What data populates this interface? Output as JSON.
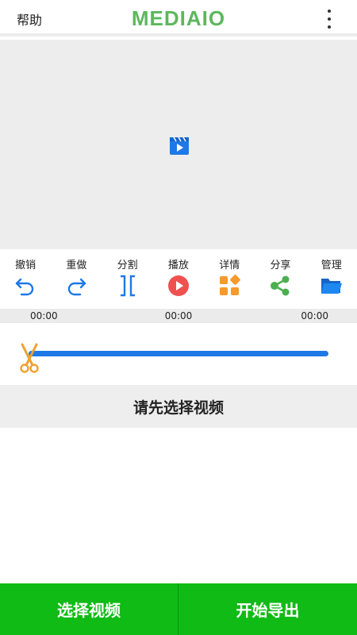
{
  "header": {
    "help_label": "帮助",
    "logo_text": "MEDIAIO",
    "logo_color": "#5cb85c"
  },
  "toolbar": {
    "items": [
      {
        "label": "撤销",
        "icon": "undo-icon",
        "color": "#1e78e6"
      },
      {
        "label": "重做",
        "icon": "redo-icon",
        "color": "#1e78e6"
      },
      {
        "label": "分割",
        "icon": "split-icon",
        "color": "#1e78e6"
      },
      {
        "label": "播放",
        "icon": "play-icon",
        "color": "#f05050"
      },
      {
        "label": "详情",
        "icon": "details-icon",
        "color": "#f59a2b"
      },
      {
        "label": "分享",
        "icon": "share-icon",
        "color": "#4caf50"
      },
      {
        "label": "管理",
        "icon": "folder-icon",
        "color": "#1e78e6"
      }
    ]
  },
  "timebar": {
    "start": "00:00",
    "current": "00:00",
    "end": "00:00"
  },
  "notice": "请先选择视频",
  "bottom": {
    "select_label": "选择视频",
    "export_label": "开始导出",
    "accent": "#11bb16"
  }
}
